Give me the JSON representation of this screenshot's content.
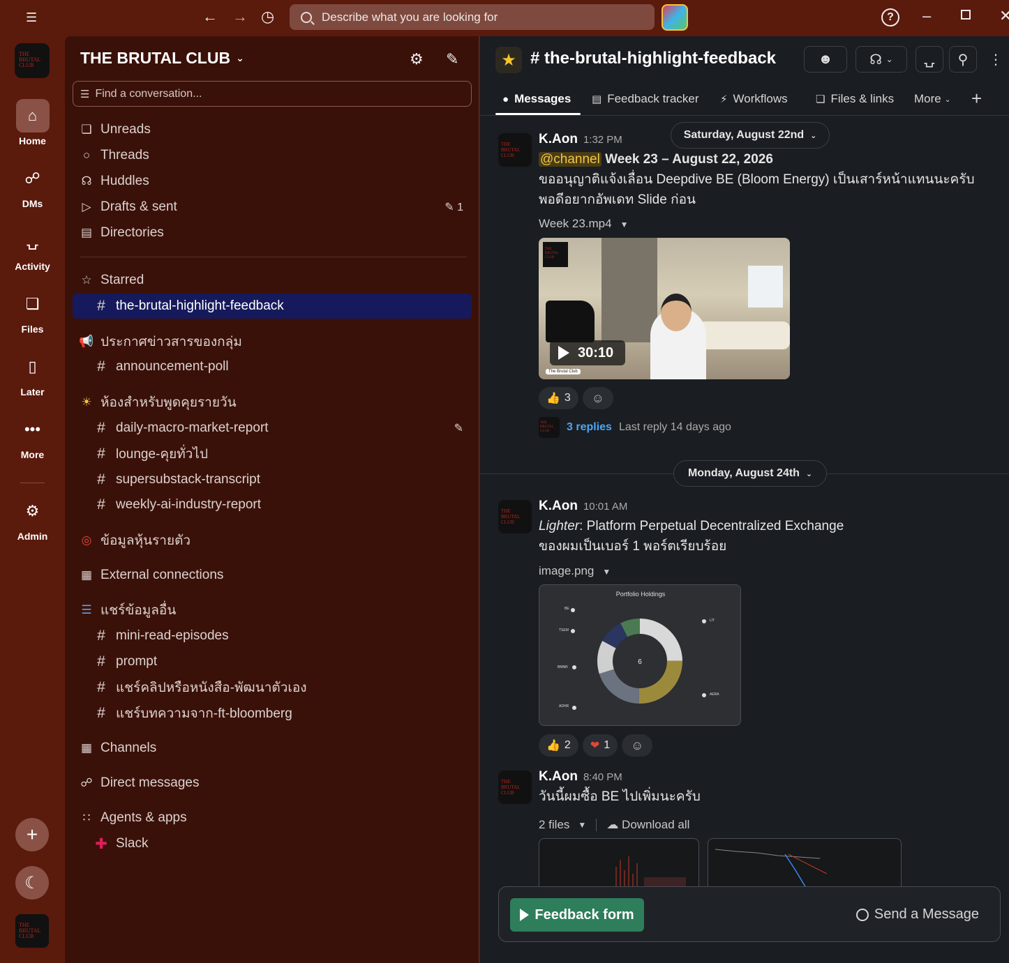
{
  "topbar": {
    "search_placeholder": "Describe what you are looking for"
  },
  "rail": {
    "workspace_logo_text": "THE BRUTAL CLUB",
    "items": [
      {
        "label": "Home",
        "icon": "home-icon"
      },
      {
        "label": "DMs",
        "icon": "dms-icon"
      },
      {
        "label": "Activity",
        "icon": "bell-icon"
      },
      {
        "label": "Files",
        "icon": "files-icon"
      },
      {
        "label": "Later",
        "icon": "bookmark-icon"
      },
      {
        "label": "More",
        "icon": "more-icon"
      },
      {
        "label": "Admin",
        "icon": "gear-icon"
      }
    ]
  },
  "sidebar": {
    "workspace_name": "THE BRUTAL CLUB",
    "find_placeholder": "Find a conversation...",
    "nav": [
      {
        "label": "Unreads",
        "icon": "unreads-icon"
      },
      {
        "label": "Threads",
        "icon": "threads-icon"
      },
      {
        "label": "Huddles",
        "icon": "headphones-icon"
      },
      {
        "label": "Drafts & sent",
        "icon": "send-icon",
        "count": "1"
      },
      {
        "label": "Directories",
        "icon": "directory-icon"
      }
    ],
    "starred_label": "Starred",
    "starred_channel": "the-brutal-highlight-feedback",
    "section_announce": "ประกาศข่าวสารของกลุ่ม",
    "announce_channels": [
      "announcement-poll"
    ],
    "section_daily": "ห้องสำหรับพูดคุยรายวัน",
    "daily_channels": [
      "daily-macro-market-report",
      "lounge-คุยทั่วไป",
      "supersubstack-transcript",
      "weekly-ai-industry-report"
    ],
    "section_stocks": "ข้อมูลหุ้นรายตัว",
    "external_label": "External connections",
    "section_share": "แชร์ข้อมูลอื่น",
    "share_channels": [
      "mini-read-episodes",
      "prompt",
      "แชร์คลิปหรือหนังสือ-พัฒนาตัวเอง",
      "แชร์บทความจาก-ft-bloomberg"
    ],
    "channels_label": "Channels",
    "dms_label": "Direct messages",
    "agents_label": "Agents & apps",
    "slack_label": "Slack"
  },
  "main": {
    "channel_name": "# the-brutal-highlight-feedback",
    "tabs": [
      "Messages",
      "Feedback tracker",
      "Workflows",
      "Files & links",
      "More"
    ],
    "date1": "Saturday, August 22nd",
    "date2": "Monday, August 24th",
    "msg1": {
      "author": "K.Aon",
      "time": "1:32 PM",
      "mention": "@channel",
      "line1": "Week 23 – August 22, 2026",
      "line2": "ขออนุญาติแจ้งเลื่อน Deepdive BE (Bloom Energy) เป็นเสาร์หน้าแทนนะครับ",
      "line3": "พอดีอยากอัพเดท Slide ก่อน",
      "file": "Week 23.mp4",
      "duration": "30:10",
      "video_caption": "The Brutal Club",
      "reaction_count": "3",
      "replies": "3 replies",
      "last_reply": "Last reply 14 days ago"
    },
    "msg2": {
      "author": "K.Aon",
      "time": "10:01 AM",
      "italic": "Lighter",
      "line1": ": Platform Perpetual Decentralized Exchange",
      "line2": "ของผมเป็นเบอร์ 1 พอร์ตเรียบร้อย",
      "file": "image.png",
      "image_title": "Portfolio Holdings",
      "chart_center": "6",
      "legend": [
        "BE",
        "TSEM",
        "BMNR",
        "ADHR",
        "LIT",
        "AERA"
      ],
      "reaction_thumbs": "2",
      "reaction_heart": "1"
    },
    "msg3": {
      "author": "K.Aon",
      "time": "8:40 PM",
      "line1": "วันนี้ผมซื้อ BE ไปเพิ่มนะครับ",
      "files": "2 files",
      "download": "Download all"
    },
    "composer": {
      "feedback_btn": "Feedback form",
      "send_btn": "Send a Message"
    }
  },
  "colors": {
    "rail_bg": "#5a1a0c",
    "sidebar_bg": "#3a1109",
    "active_channel": "#161a5c",
    "main_bg": "#1a1d21",
    "link": "#4ea5f2",
    "feedback_green": "#2e7d5b"
  }
}
